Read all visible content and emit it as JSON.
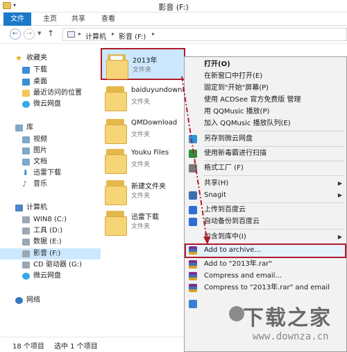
{
  "window": {
    "title": "影音 (F:)"
  },
  "ribbon": {
    "tabs": [
      "文件",
      "主页",
      "共享",
      "查看"
    ]
  },
  "address": {
    "segments": [
      "计算机",
      "影音 (F:)"
    ]
  },
  "sidebar": {
    "favorites": {
      "label": "收藏夹",
      "items": [
        "下载",
        "桌面",
        "最近访问的位置",
        "微云网盘"
      ]
    },
    "libraries": {
      "label": "库",
      "items": [
        "视频",
        "图片",
        "文档",
        "迅雷下载",
        "音乐"
      ]
    },
    "computer": {
      "label": "计算机",
      "items": [
        "WIN8 (C:)",
        "工具 (D:)",
        "数据 (E:)",
        "影音 (F:)",
        "CD 驱动器 (G:)",
        "微云网盘"
      ]
    },
    "network": {
      "label": "网络"
    }
  },
  "files": [
    {
      "name": "2013年",
      "type": "文件夹"
    },
    {
      "name": "baiduyundownlo",
      "type": "文件夹"
    },
    {
      "name": "QMDownload",
      "type": "文件夹"
    },
    {
      "name": "Youku Files",
      "type": "文件夹"
    },
    {
      "name": "新建文件夹",
      "type": "文件夹"
    },
    {
      "name": "迅雷下载",
      "type": "文件夹"
    }
  ],
  "status": {
    "count": "18 个项目",
    "selected": "选中 1 个项目"
  },
  "context_menu": {
    "items": [
      {
        "label": "打开(O)",
        "bold": true
      },
      {
        "label": "在新窗口中打开(E)"
      },
      {
        "label": "固定到\"开始\"屏幕(P)"
      },
      {
        "label": "使用 ACDSee 官方免费版 管理"
      },
      {
        "label": "用 QQMusic 播放(P)"
      },
      {
        "label": "加入 QQMusic 播放队列(E)"
      },
      {
        "label": "另存到微云网盘",
        "icon": "weiyun-icon"
      },
      {
        "label": "使用新毒霸进行扫描",
        "icon": "antivirus-icon"
      },
      {
        "label": "格式工厂 (F)",
        "icon": "format-factory-icon"
      },
      {
        "label": "共享(H)",
        "submenu": true
      },
      {
        "label": "Snagit",
        "submenu": true,
        "icon": "snagit-icon"
      },
      {
        "label": "上传到百度云",
        "icon": "baidu-cloud-icon"
      },
      {
        "label": "自动备份到百度云",
        "icon": "baidu-cloud-icon"
      },
      {
        "label": "包含到库中(I)",
        "submenu": true
      },
      {
        "label": "Add to archive...",
        "icon": "winrar-icon",
        "highlighted": true
      },
      {
        "label": "Add to \"2013年.rar\"",
        "icon": "winrar-icon"
      },
      {
        "label": "Compress and email...",
        "icon": "winrar-icon"
      },
      {
        "label": "Compress to \"2013年.rar\" and email",
        "icon": "winrar-icon"
      },
      {
        "label": "",
        "icon": "shield-icon"
      }
    ]
  },
  "watermark": {
    "title": "下载之家",
    "url": "www.downza.cn"
  },
  "colors": {
    "accent": "#1979ca",
    "selection": "#cce8ff",
    "highlight_border": "#b11b2b"
  }
}
